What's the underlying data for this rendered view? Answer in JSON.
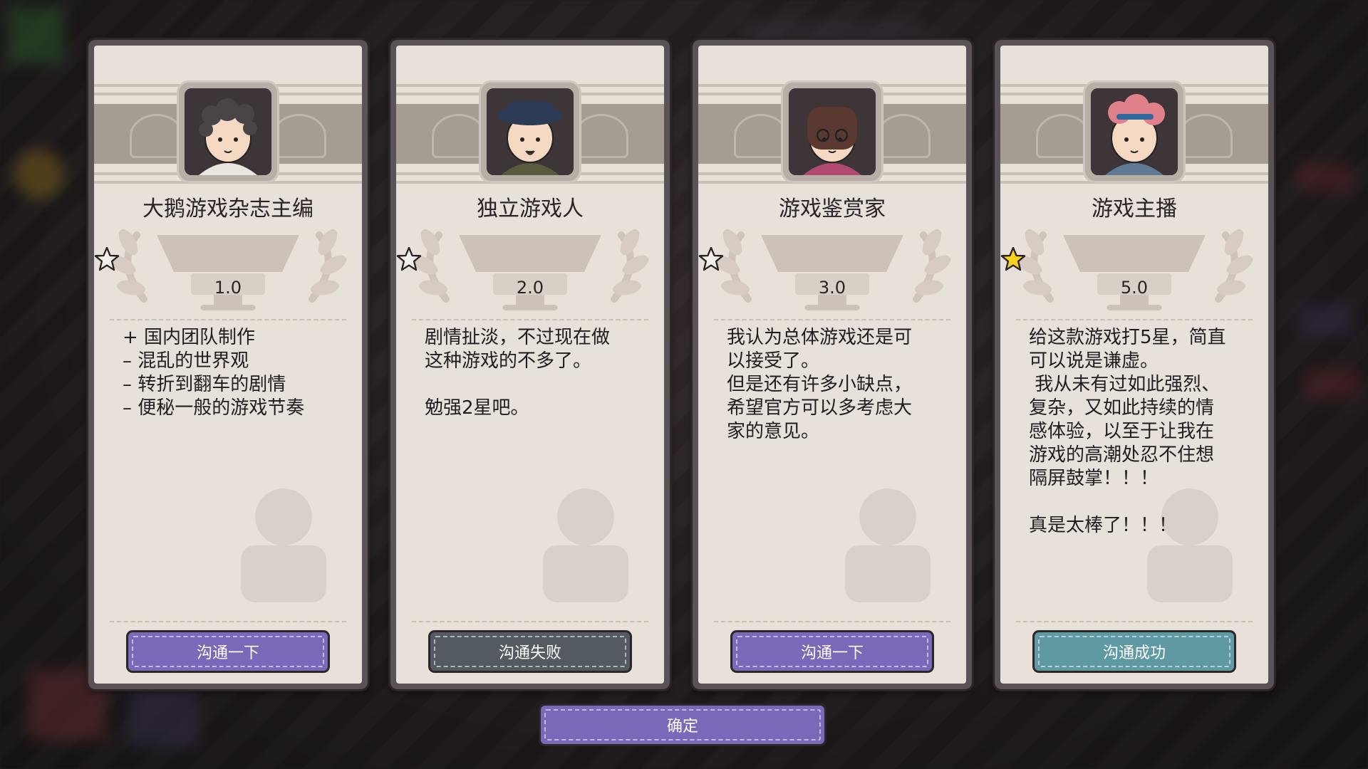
{
  "reviews": [
    {
      "reviewer": "大鹅游戏杂志主编",
      "rating": 1,
      "score_text": "1.0",
      "review_text": "+ 国内团队制作\n– 混乱的世界观\n– 转折到翻车的剧情\n– 便秘一般的游戏节奏",
      "button_label": "沟通一下",
      "button_style": "purple",
      "avatar": "curly-hair-editor-avatar"
    },
    {
      "reviewer": "独立游戏人",
      "rating": 2,
      "score_text": "2.0",
      "review_text": "剧情扯淡，不过现在做\n这种游戏的不多了。\n\n勉强2星吧。",
      "button_label": "沟通失败",
      "button_style": "gray",
      "avatar": "hat-goatee-indie-avatar"
    },
    {
      "reviewer": "游戏鉴赏家",
      "rating": 3,
      "score_text": "3.0",
      "review_text": "我认为总体游戏还是可\n以接受了。\n但是还有许多小缺点，\n希望官方可以多考虑大\n家的意见。",
      "button_label": "沟通一下",
      "button_style": "purple",
      "avatar": "glasses-connoisseur-avatar"
    },
    {
      "reviewer": "游戏主播",
      "rating": 5,
      "score_text": "5.0",
      "review_text": "给这款游戏打5星，简直\n可以说是谦虚。\n 我从未有过如此强烈、\n复杂，又如此持续的情\n感体验，以至于让我在\n游戏的高潮处忍不住想\n隔屏鼓掌！！！\n\n真是太棒了！！！",
      "button_label": "沟通成功",
      "button_style": "teal",
      "avatar": "pink-hair-streamer-avatar"
    }
  ],
  "max_stars": 5,
  "confirm_label": "确定",
  "colors": {
    "star_filled": "#f6d21e",
    "button_purple": "#7a68b8",
    "button_gray": "#535a62",
    "button_teal": "#5f9aa2",
    "card_bg": "#e7e1da"
  }
}
